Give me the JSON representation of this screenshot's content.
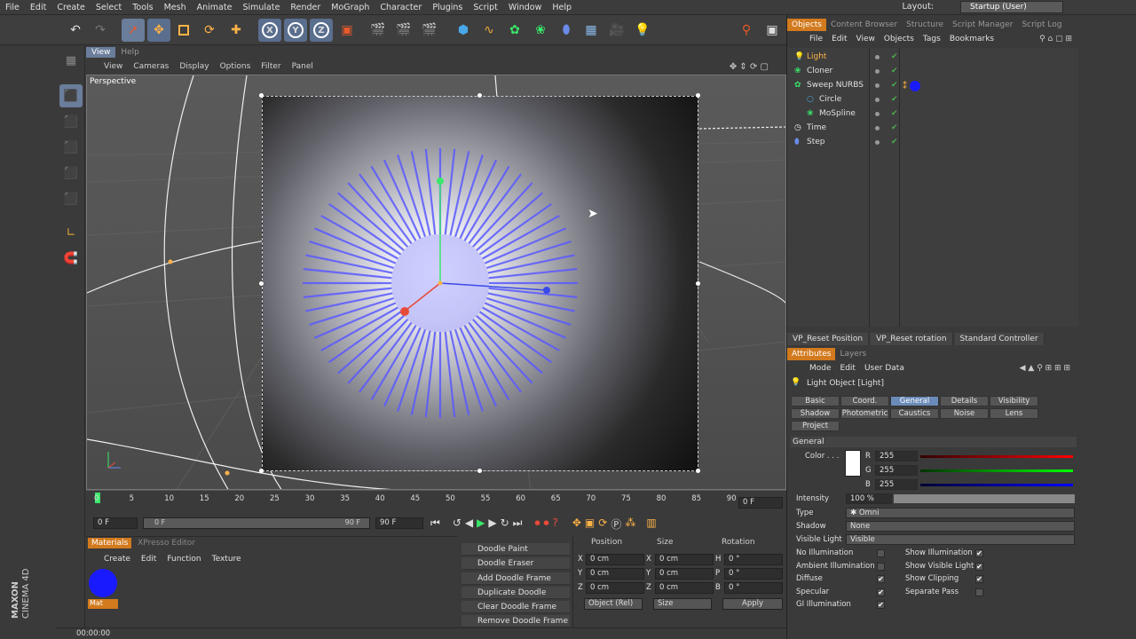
{
  "menubar": {
    "items": [
      "File",
      "Edit",
      "Create",
      "Select",
      "Tools",
      "Mesh",
      "Animate",
      "Simulate",
      "Render",
      "MoGraph",
      "Character",
      "Plugins",
      "Script",
      "Window",
      "Help"
    ],
    "layout_label": "Layout:",
    "layout_value": "Startup (User)"
  },
  "viewport": {
    "tabs": [
      "View",
      "Help"
    ],
    "menu": [
      "View",
      "Cameras",
      "Display",
      "Options",
      "Filter",
      "Panel"
    ],
    "label": "Perspective"
  },
  "timeline": {
    "ticks": [
      "0",
      "5",
      "10",
      "15",
      "20",
      "25",
      "30",
      "35",
      "40",
      "45",
      "50",
      "55",
      "60",
      "65",
      "70",
      "75",
      "80",
      "85",
      "90"
    ],
    "current_frame": "0 F",
    "start_frame": "0 F",
    "range_start": "0 F",
    "range_end": "90 F",
    "end_frame": "90 F"
  },
  "materials": {
    "tabs": [
      "Materials",
      "XPresso Editor"
    ],
    "menu": [
      "Create",
      "Edit",
      "Function",
      "Texture"
    ],
    "material_name": "Mat",
    "material_color": "#1a1aff"
  },
  "doodle": {
    "items": [
      "Doodle Paint",
      "Doodle Eraser",
      "Add Doodle Frame",
      "Duplicate Doodle Frame",
      "Clear Doodle Frame",
      "Remove Doodle Frame"
    ]
  },
  "coords": {
    "headers": [
      "Position",
      "Size",
      "Rotation"
    ],
    "rows": [
      {
        "axis": "X",
        "pos": "0 cm",
        "saxis": "X",
        "size": "0 cm",
        "raxis": "H",
        "rot": "0 °"
      },
      {
        "axis": "Y",
        "pos": "0 cm",
        "saxis": "Y",
        "size": "0 cm",
        "raxis": "P",
        "rot": "0 °"
      },
      {
        "axis": "Z",
        "pos": "0 cm",
        "saxis": "Z",
        "size": "0 cm",
        "raxis": "B",
        "rot": "0 °"
      }
    ],
    "mode": "Object (Rel)",
    "size_mode": "Size",
    "apply": "Apply"
  },
  "status": {
    "time": "00:00:00"
  },
  "objects": {
    "tabs": [
      "Objects",
      "Content Browser",
      "Structure",
      "Script Manager",
      "Script Log"
    ],
    "menu": [
      "File",
      "Edit",
      "View",
      "Objects",
      "Tags",
      "Bookmarks"
    ],
    "list": [
      {
        "name": "Light",
        "color": "#ffb347"
      },
      {
        "name": "Cloner",
        "color": "#e0e0e0"
      },
      {
        "name": "Sweep NURBS",
        "color": "#e0e0e0"
      },
      {
        "name": "Circle",
        "color": "#e0e0e0"
      },
      {
        "name": "MoSpline",
        "color": "#e0e0e0"
      },
      {
        "name": "Time",
        "color": "#e0e0e0"
      },
      {
        "name": "Step",
        "color": "#e0e0e0"
      }
    ]
  },
  "vp_buttons": [
    "VP_Reset Position",
    "VP_Reset rotation",
    "Standard Controller"
  ],
  "attributes": {
    "tabs": [
      "Attributes",
      "Layers"
    ],
    "menu": [
      "Mode",
      "Edit",
      "User Data"
    ],
    "title": "Light Object [Light]",
    "tab_row1": [
      "Basic",
      "Coord.",
      "General",
      "Details",
      "Visibility"
    ],
    "tab_row2": [
      "Shadow",
      "Photometric",
      "Caustics",
      "Noise",
      "Lens"
    ],
    "tab_row3": [
      "Project"
    ],
    "section": "General",
    "color_label": "Color . . .",
    "r_label": "R",
    "r": "255",
    "g_label": "G",
    "g": "255",
    "b_label": "B",
    "b": "255",
    "intensity_label": "Intensity",
    "intensity": "100 %",
    "type_label": "Type",
    "type": "Omni",
    "shadow_label": "Shadow",
    "shadow": "None",
    "visible_light_label": "Visible Light",
    "visible_light": "Visible",
    "checks_left": [
      {
        "label": "No Illumination",
        "checked": ""
      },
      {
        "label": "Ambient Illumination",
        "checked": ""
      },
      {
        "label": "Diffuse",
        "checked": "✔"
      },
      {
        "label": "Specular",
        "checked": "✔"
      },
      {
        "label": "GI Illumination",
        "checked": "✔"
      }
    ],
    "checks_right": [
      {
        "label": "Show Illumination",
        "checked": "✔"
      },
      {
        "label": "Show Visible Light",
        "checked": "✔"
      },
      {
        "label": "Show Clipping",
        "checked": "✔"
      },
      {
        "label": "Separate Pass",
        "checked": ""
      }
    ]
  },
  "logo": {
    "line1": "MAXON",
    "line2": "CINEMA 4D"
  }
}
